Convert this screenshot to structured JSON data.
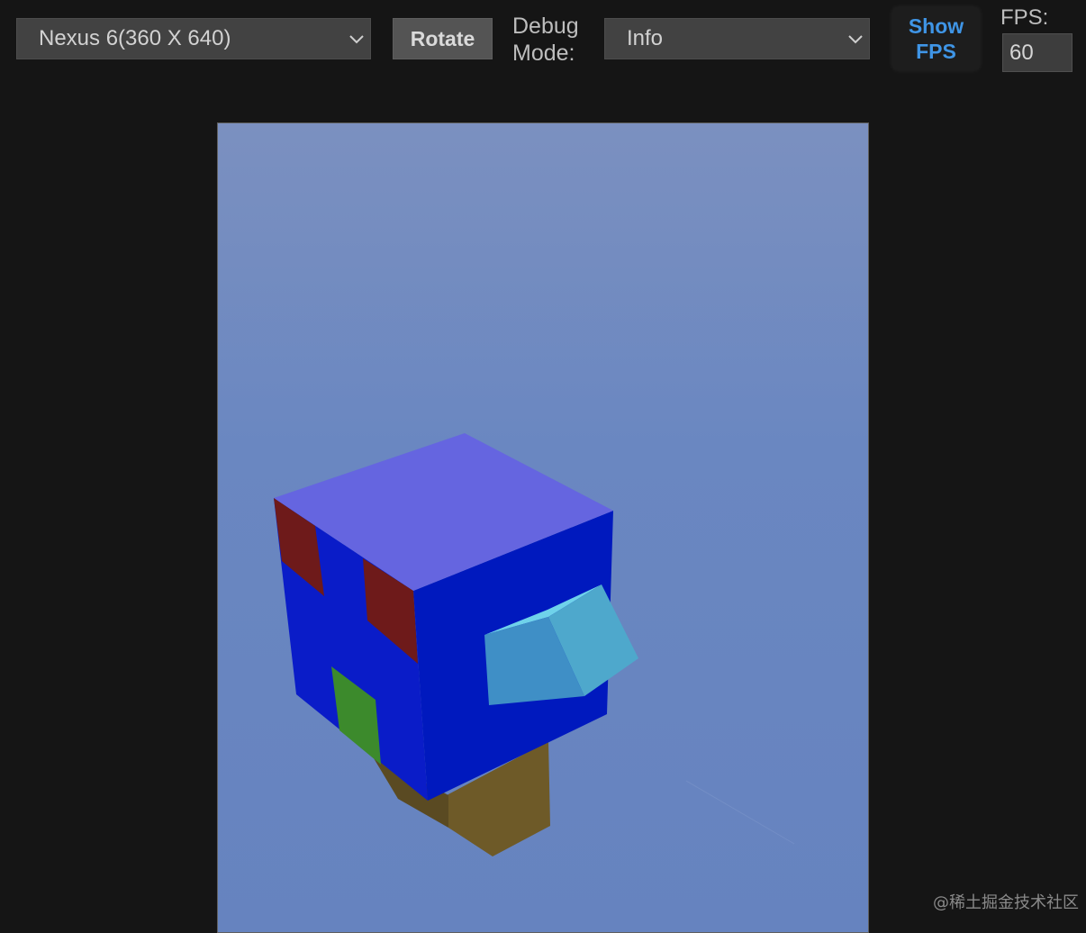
{
  "toolbar": {
    "device_select": {
      "value": "Nexus 6(360 X 640)"
    },
    "rotate_label": "Rotate",
    "debug_mode_label": "Debug Mode:",
    "debug_select": {
      "value": "Info"
    },
    "show_fps_label": "Show FPS",
    "fps_label": "FPS:",
    "fps_value": "60"
  },
  "viewport": {
    "background_color": "#6a87c1",
    "scene": {
      "colors": {
        "cube_top": "#6565e0",
        "cube_left": "#0a1cc8",
        "cube_right": "#0019be",
        "red_patch": "#6e1a1a",
        "green_patch": "#3c8a2c",
        "beak_front": "#3f8fc6",
        "beak_side": "#4ea8cc",
        "beak_top": "#6fd2ea",
        "leg": "#6e5a28"
      }
    }
  },
  "watermark": "@稀土掘金技术社区"
}
